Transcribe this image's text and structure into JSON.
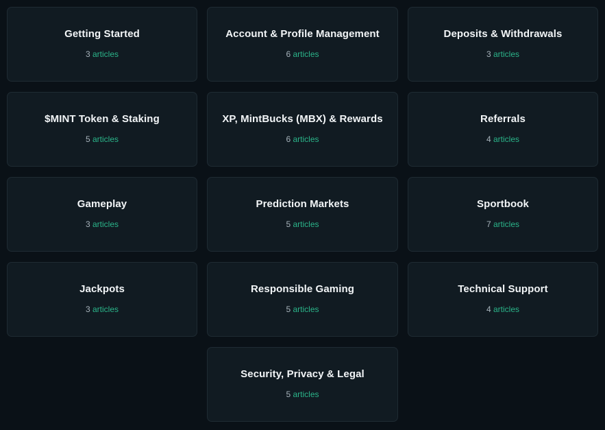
{
  "colors": {
    "background": "#0a1117",
    "card": "#111b22",
    "card_border": "#1f2b33",
    "title": "#f2f5f7",
    "count": "#a7b3bb",
    "accent": "#2bb58a"
  },
  "categories": [
    {
      "title": "Getting Started",
      "count": "3",
      "unit": "articles"
    },
    {
      "title": "Account & Profile Management",
      "count": "6",
      "unit": "articles"
    },
    {
      "title": "Deposits & Withdrawals",
      "count": "3",
      "unit": "articles"
    },
    {
      "title": "$MINT Token & Staking",
      "count": "5",
      "unit": "articles"
    },
    {
      "title": "XP, MintBucks (MBX) & Rewards",
      "count": "6",
      "unit": "articles"
    },
    {
      "title": "Referrals",
      "count": "4",
      "unit": "articles"
    },
    {
      "title": "Gameplay",
      "count": "3",
      "unit": "articles"
    },
    {
      "title": "Prediction Markets",
      "count": "5",
      "unit": "articles"
    },
    {
      "title": "Sportbook",
      "count": "7",
      "unit": "articles"
    },
    {
      "title": "Jackpots",
      "count": "3",
      "unit": "articles"
    },
    {
      "title": "Responsible Gaming",
      "count": "5",
      "unit": "articles"
    },
    {
      "title": "Technical Support",
      "count": "4",
      "unit": "articles"
    },
    {
      "title": "Security, Privacy & Legal",
      "count": "5",
      "unit": "articles"
    }
  ]
}
